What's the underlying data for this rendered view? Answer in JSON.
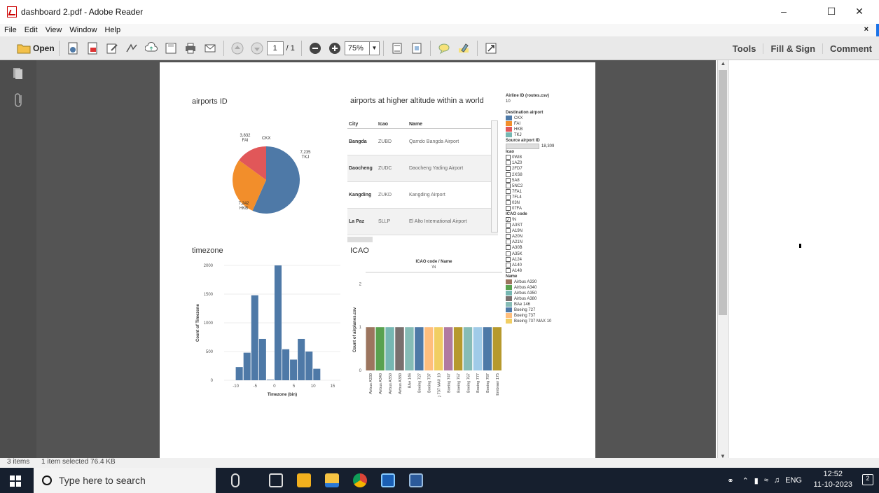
{
  "window": {
    "title": "dashboard 2.pdf - Adobe Reader"
  },
  "menu": [
    "File",
    "Edit",
    "View",
    "Window",
    "Help"
  ],
  "toolbar": {
    "open_label": "Open",
    "page_current": "1",
    "page_total": "/ 1",
    "zoom": "75%",
    "tools": "Tools",
    "fill_sign": "Fill & Sign",
    "comment": "Comment"
  },
  "status": {
    "items": "3 items",
    "selected": "1 item selected  76.4 KB"
  },
  "taskbar": {
    "search_placeholder": "Type here to search",
    "lang": "ENG",
    "time": "12:52",
    "date": "11-10-2023",
    "notif_count": "2"
  },
  "dashboard": {
    "pie_title": "airports ID",
    "table_title": "airports at higher altitude within a world",
    "hist_title": "timezone",
    "bar_title": "ICAO",
    "table_headers": [
      "City",
      "Icao",
      "Name"
    ],
    "table_rows": [
      [
        "Bangda",
        "ZUBD",
        "Qamdo Bangda Airport"
      ],
      [
        "Daocheng",
        "ZUDC",
        "Daocheng Yading Airport"
      ],
      [
        "Kangding",
        "ZUKD",
        "Kangding Airport"
      ],
      [
        "La Paz",
        "SLLP",
        "El Alto International Airport"
      ]
    ],
    "airline_label": "Airline ID (routes.csv)",
    "airline_value": "10",
    "dest_label": "Destination airport",
    "dest_items": [
      {
        "name": "CKX",
        "color": "#4e79a7"
      },
      {
        "name": "FAI",
        "color": "#f28e2b"
      },
      {
        "name": "HKB",
        "color": "#e15759"
      },
      {
        "name": "TKJ",
        "color": "#76b7b2"
      }
    ],
    "source_label": "Source airport ID",
    "source_value": "18,309",
    "icao_label": "Icao",
    "icao_items": [
      "0WI8",
      "1AZ0",
      "2FD7",
      "2XS8",
      "5A8",
      "5NC2",
      "7FA1",
      "7FL4",
      "03N",
      "07FA"
    ],
    "icao_code_label": "ICAO code",
    "icao_code_items": [
      "\\N",
      "A3ST",
      "A19N",
      "A20N",
      "A21N",
      "A30B",
      "A35K",
      "A124",
      "A140",
      "A148"
    ],
    "name_label": "Name",
    "name_items": [
      {
        "name": "Airbus A330",
        "color": "#9c755f"
      },
      {
        "name": "Airbus A340",
        "color": "#59a14f"
      },
      {
        "name": "Airbus A350",
        "color": "#76b7b2"
      },
      {
        "name": "Airbus A380",
        "color": "#79706e"
      },
      {
        "name": "BAe 146",
        "color": "#86bcb6"
      },
      {
        "name": "Boeing 727",
        "color": "#4e79a7"
      },
      {
        "name": "Boeing 737",
        "color": "#ffbe7d"
      },
      {
        "name": "Boeing 737 MAX 10",
        "color": "#f1ce63"
      }
    ]
  },
  "chart_data": [
    {
      "type": "pie",
      "title": "airports ID",
      "labels": [
        "CKX",
        "TKJ",
        "HKB",
        "FAI"
      ],
      "values": [
        7235,
        7235,
        7242,
        3832
      ],
      "slice_labels": [
        "CKX",
        "7,235\nTKJ",
        "7,242\nHKB",
        "3,832\nFAI"
      ],
      "colors": [
        "#4e79a7",
        "#4e79a7",
        "#f28e2b",
        "#e15759"
      ]
    },
    {
      "type": "bar",
      "title": "timezone",
      "xlabel": "Timezone (bin)",
      "ylabel": "Count of Timezone",
      "x_ticks": [
        "-10",
        "-5",
        "0",
        "5",
        "10",
        "15"
      ],
      "y_ticks": [
        "0",
        "500",
        "1000",
        "1500",
        "2000"
      ],
      "ylim": [
        0,
        2000
      ],
      "bins": [
        -10,
        -8,
        -6,
        -4,
        -2,
        0,
        2,
        4,
        6,
        8,
        10
      ],
      "values": [
        230,
        480,
        1480,
        720,
        10,
        2000,
        540,
        360,
        720,
        500,
        200
      ]
    },
    {
      "type": "bar",
      "title": "ICAO",
      "header": "ICAO code  /  Name",
      "header_value": "\\N",
      "ylabel": "Count of airplanes.csv",
      "y_ticks": [
        "0",
        "1",
        "2"
      ],
      "ylim": [
        0,
        2.2
      ],
      "categories": [
        "Airbus A330",
        "Airbus A340",
        "Airbus A350",
        "Airbus A380",
        "BAe 146",
        "Boeing 727",
        "Boeing 737",
        "Boeing 737 MAX 10",
        "Boeing 747",
        "Boeing 757",
        "Boeing 767",
        "Boeing 777",
        "Boeing 787",
        "Embraer 175"
      ],
      "values": [
        1,
        1,
        1,
        1,
        1,
        1,
        1,
        1,
        1,
        1,
        1,
        1,
        1,
        1
      ],
      "colors": [
        "#9c755f",
        "#59a14f",
        "#76b7b2",
        "#79706e",
        "#86bcb6",
        "#4e79a7",
        "#ffbe7d",
        "#f1ce63",
        "#b07aa1",
        "#b6992d",
        "#86bcb6",
        "#a0cbe8",
        "#4e79a7",
        "#b6992d"
      ]
    }
  ]
}
